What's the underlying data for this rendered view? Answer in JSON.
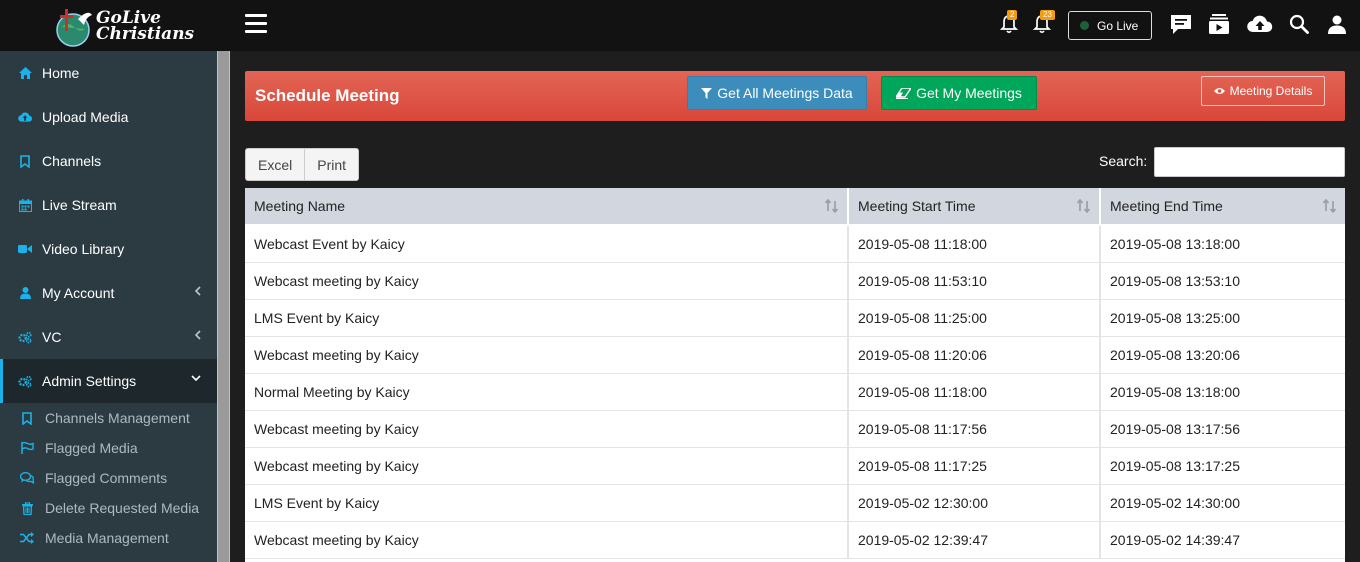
{
  "brand": {
    "line1": "GoLive",
    "line2": "Christians"
  },
  "topbar": {
    "notif_badge_1": "2",
    "notif_badge_2": "23",
    "golive_label": "Go Live",
    "icons": [
      "menu-icon",
      "bell-icon",
      "bell-ring-icon",
      "chat-icon",
      "video-playlist-icon",
      "upload-cloud-icon",
      "search-icon",
      "user-icon"
    ]
  },
  "sidebar": {
    "items": [
      {
        "label": "Home",
        "icon": "home-icon"
      },
      {
        "label": "Upload Media",
        "icon": "upload-cloud-icon"
      },
      {
        "label": "Channels",
        "icon": "bookmark-icon"
      },
      {
        "label": "Live Stream",
        "icon": "calendar-icon"
      },
      {
        "label": "Video Library",
        "icon": "video-camera-icon"
      },
      {
        "label": "My Account",
        "icon": "user-icon"
      },
      {
        "label": "VC",
        "icon": "cogs-icon"
      },
      {
        "label": "Admin Settings",
        "icon": "cogs-icon"
      }
    ],
    "subitems": [
      {
        "label": "Channels Management",
        "icon": "bookmark-icon"
      },
      {
        "label": "Flagged Media",
        "icon": "flag-icon"
      },
      {
        "label": "Flagged Comments",
        "icon": "comments-icon"
      },
      {
        "label": "Delete Requested Media",
        "icon": "trash-icon"
      },
      {
        "label": "Media Management",
        "icon": "shuffle-icon"
      }
    ]
  },
  "header": {
    "title": "Schedule Meeting",
    "btn_all": "Get All Meetings Data",
    "btn_my": "Get My Meetings",
    "btn_details": "Meeting Details"
  },
  "toolbar": {
    "excel": "Excel",
    "print": "Print",
    "search_label": "Search:",
    "search_value": ""
  },
  "table": {
    "columns": [
      "Meeting Name",
      "Meeting Start Time",
      "Meeting End Time"
    ],
    "rows": [
      [
        "Webcast Event by Kaicy",
        "2019-05-08 11:18:00",
        "2019-05-08 13:18:00"
      ],
      [
        "Webcast meeting by Kaicy",
        "2019-05-08 11:53:10",
        "2019-05-08 13:53:10"
      ],
      [
        "LMS Event by Kaicy",
        "2019-05-08 11:25:00",
        "2019-05-08 13:25:00"
      ],
      [
        "Webcast meeting by Kaicy",
        "2019-05-08 11:20:06",
        "2019-05-08 13:20:06"
      ],
      [
        "Normal Meeting by Kaicy",
        "2019-05-08 11:18:00",
        "2019-05-08 13:18:00"
      ],
      [
        "Webcast meeting by Kaicy",
        "2019-05-08 11:17:56",
        "2019-05-08 13:17:56"
      ],
      [
        "Webcast meeting by Kaicy",
        "2019-05-08 11:17:25",
        "2019-05-08 13:17:25"
      ],
      [
        "LMS Event by Kaicy",
        "2019-05-02 12:30:00",
        "2019-05-02 14:30:00"
      ],
      [
        "Webcast meeting by Kaicy",
        "2019-05-02 12:39:47",
        "2019-05-02 14:39:47"
      ]
    ]
  },
  "colors": {
    "accent": "#1ab2e8",
    "header_red": "#dc4f41",
    "btn_blue": "#3c8dbc",
    "btn_green": "#00a65a"
  }
}
